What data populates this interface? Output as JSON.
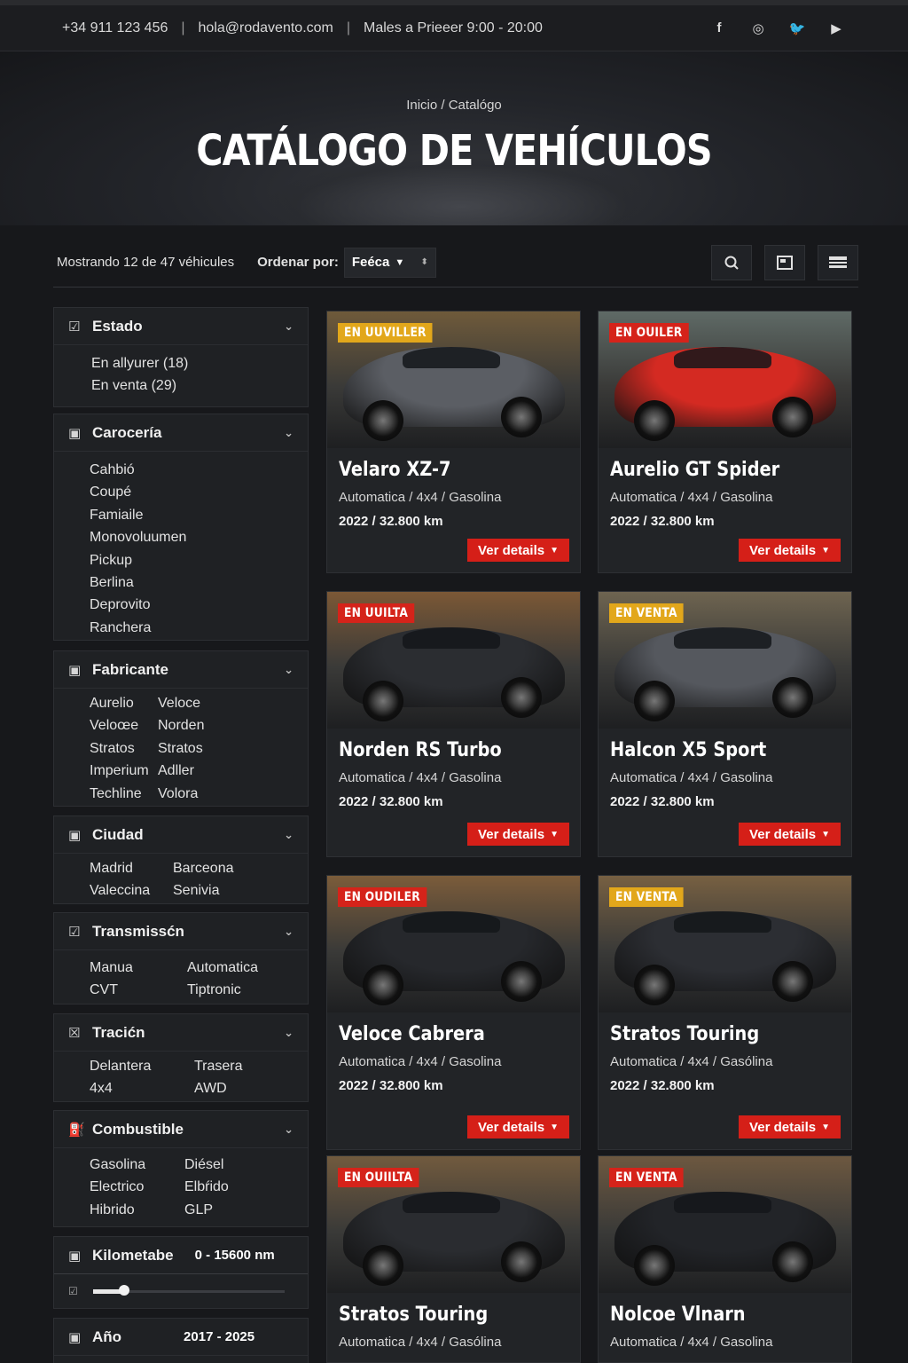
{
  "topbar": {
    "phone": "+34 911 123 456",
    "email": "hola@rodavento.com",
    "hours": "Males a Prieeer 9:00 - 20:00",
    "separator": "|",
    "social": [
      {
        "icon": "facebook-icon",
        "glyph": "f"
      },
      {
        "icon": "instagram-icon",
        "glyph": "◎"
      },
      {
        "icon": "twitter-icon",
        "glyph": "🐦"
      },
      {
        "icon": "youtube-icon",
        "glyph": "▶"
      }
    ]
  },
  "hero": {
    "breadcrumb": "Inicio / Catalógo",
    "title": "CATÁLOGO DE VEHÍCULOS"
  },
  "toolbar": {
    "count_text": "Mostrando 12 de 47 véhicules",
    "sort_label": "Ordenar por:",
    "sort_value": "Feéca"
  },
  "filters": {
    "estado": {
      "title": "Estado",
      "options": [
        "En allyurer (18)",
        "En venta (29)"
      ]
    },
    "carroceria": {
      "title": "Carocería",
      "options": [
        "Cahbió",
        "Coupé",
        "Famiaile",
        "Monovoluumen",
        "Pickup",
        "Berlina",
        "Deprovito",
        "Ranchera"
      ]
    },
    "fabricante": {
      "title": "Fabricante",
      "options": [
        "Aurelio",
        "Veloce",
        "Veloœe",
        "Norden",
        "Stratos",
        "Stratos",
        "Imperium",
        "Adller",
        "Techline",
        "Volora"
      ]
    },
    "ciudad": {
      "title": "Ciudad",
      "options": [
        "Madrid",
        "Barceona",
        "Valeccina",
        "Senivia"
      ]
    },
    "transmision": {
      "title": "Transmissćn",
      "options": [
        "Manua",
        "Automatica",
        "CVT",
        "Tiptronic"
      ]
    },
    "traccion": {
      "title": "Tracićn",
      "options": [
        "Delantera",
        "Trasera",
        "4x4",
        "AWD"
      ]
    },
    "combustible": {
      "title": "Combustible",
      "options": [
        "Gasolina",
        "Diésel",
        "Electrico",
        "Elbŕido",
        "Hibrido",
        "GLP"
      ]
    },
    "kilometraje": {
      "title": "Kilometabe",
      "range": "0 - 15600 nm",
      "fill_fraction": 0.16
    },
    "anio": {
      "title": "Año",
      "range": "2017 - 2025"
    }
  },
  "cards": [
    {
      "badge": "EN UUVILLER",
      "badge_color": "#e2a71b",
      "title": "Velaro XZ-7",
      "specs": "Automatica / 4x4 / Gasolina",
      "meta": "2022 / 32.800 km",
      "button": "Ver details",
      "car_color": "#5b5e64",
      "sky": "#6f5a3a"
    },
    {
      "badge": "EN OUILER",
      "badge_color": "#d5231a",
      "title": "Aurelio GT Spider",
      "specs": "Automatica / 4x4 / Gasolina",
      "meta": "2022 / 32.800 km",
      "button": "Ver details",
      "car_color": "#d42a22",
      "sky": "#5f6a66"
    },
    {
      "badge": "EN UUILTA",
      "badge_color": "#d5231a",
      "title": "Norden RS Turbo",
      "specs": "Automatica / 4x4 / Gasolina",
      "meta": "2022 / 32.800 km",
      "button": "Ver details",
      "car_color": "#2b2d31",
      "sky": "#7b5836"
    },
    {
      "badge": "EN VENTA",
      "badge_color": "#e2a71b",
      "title": "Halcon X5 Sport",
      "specs": "Automatica / 4x4 / Gasolina",
      "meta": "2022 / 32.800 km",
      "button": "Ver details",
      "car_color": "#55585e",
      "sky": "#6e6450"
    },
    {
      "badge": "EN OUDILER",
      "badge_color": "#d5231a",
      "title": "Veloce Cabrera",
      "specs": "Automatica / 4x4 / Gasolina",
      "meta": "2022 / 32.800 km",
      "button": "Ver details",
      "car_color": "#26282c",
      "sky": "#7b5c3a"
    },
    {
      "badge": "EN VENTA",
      "badge_color": "#e2a71b",
      "title": "Stratos Touring",
      "specs": "Automatica / 4x4 / Gasólina",
      "meta": "2022 / 32.800 km",
      "button": "Ver details",
      "car_color": "#2c2e33",
      "sky": "#776042"
    },
    {
      "badge": "EN OUIILTA",
      "badge_color": "#d5231a",
      "title": "Stratos Touring",
      "specs": "Automatica / 4x4 / Gasólina",
      "meta": "",
      "button": "",
      "car_color": "#2a2c30",
      "sky": "#715a3e"
    },
    {
      "badge": "EN VENTA",
      "badge_color": "#d5231a",
      "title": "Nolcoe Vlnarn",
      "specs": "Automatica / 4x4 / Gasolina",
      "meta": "",
      "button": "",
      "car_color": "#222428",
      "sky": "#6d5840"
    }
  ]
}
